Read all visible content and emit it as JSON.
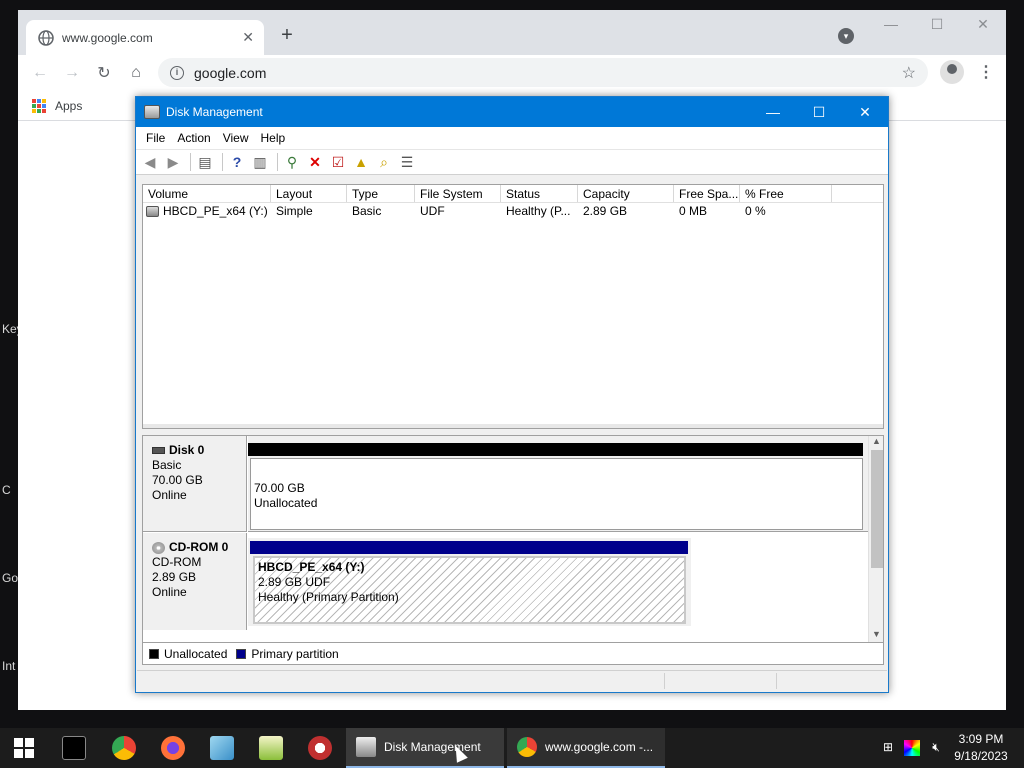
{
  "desktop": {
    "labels": [
      "Key",
      "C",
      "Go",
      "Int"
    ]
  },
  "chrome": {
    "tab_title": "www.google.com",
    "url": "google.com",
    "bookmark_apps": "Apps"
  },
  "disk_mgmt": {
    "title": "Disk Management",
    "menu": [
      "File",
      "Action",
      "View",
      "Help"
    ],
    "columns": [
      "Volume",
      "Layout",
      "Type",
      "File System",
      "Status",
      "Capacity",
      "Free Spa...",
      "% Free"
    ],
    "volumes": [
      {
        "volume": "HBCD_PE_x64 (Y:)",
        "layout": "Simple",
        "type": "Basic",
        "fs": "UDF",
        "status": "Healthy (P...",
        "capacity": "2.89 GB",
        "free": "0 MB",
        "pct_free": "0 %"
      }
    ],
    "disks": [
      {
        "name": "Disk 0",
        "kind": "Basic",
        "size": "70.00 GB",
        "state": "Online",
        "part_size": "70.00 GB",
        "part_label": "Unallocated"
      },
      {
        "name": "CD-ROM 0",
        "kind": "CD-ROM",
        "size": "2.89 GB",
        "state": "Online",
        "part_name": "HBCD_PE_x64  (Y:)",
        "part_size": "2.89 GB UDF",
        "part_status": "Healthy (Primary Partition)"
      }
    ],
    "legend": {
      "unallocated": "Unallocated",
      "primary": "Primary partition"
    },
    "colors": {
      "unallocated": "#000000",
      "primary": "#00008b",
      "titlebar": "#0078d7"
    }
  },
  "taskbar": {
    "apps": [
      {
        "label": "Disk Management"
      },
      {
        "label": "www.google.com -..."
      }
    ],
    "time": "3:09 PM",
    "date": "9/18/2023"
  }
}
